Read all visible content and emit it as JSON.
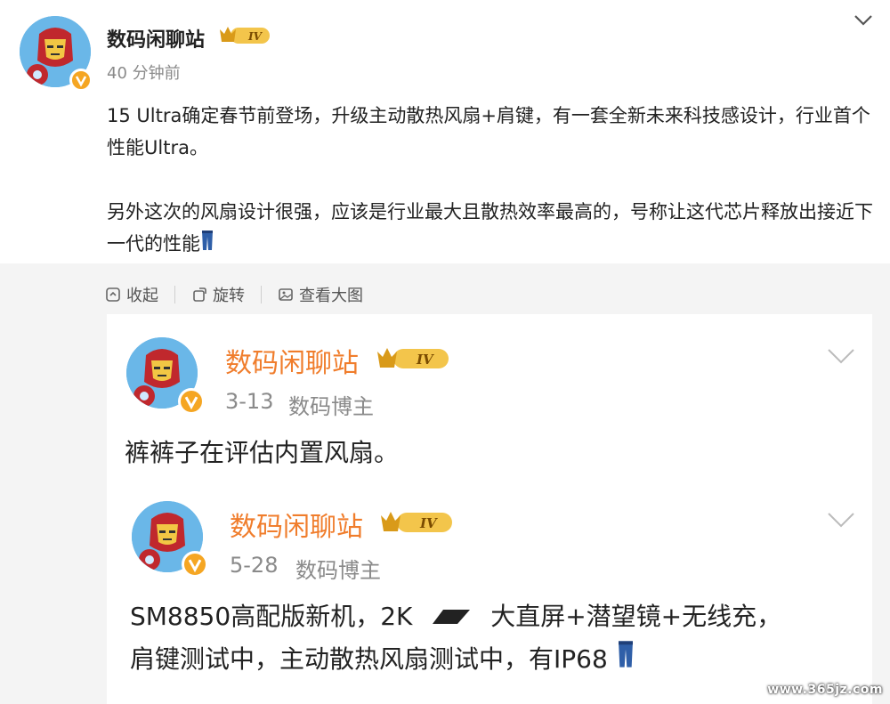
{
  "post": {
    "username": "数码闲聊站",
    "level": "IV",
    "time": "40 分钟前",
    "paragraph1": "15 Ultra确定春节前登场，升级主动散热风扇+肩键，有一套全新未来科技感设计，行业首个性能Ultra。",
    "paragraph2": "另外这次的风扇设计很强，应该是行业最大且散热效率最高的，号称让这代芯片释放出接近下一代的性能",
    "emoji": "jeans-emoji",
    "actions": [
      {
        "label": "收起",
        "icon": "collapse-icon"
      },
      {
        "label": "旋转",
        "icon": "rotate-icon"
      },
      {
        "label": "查看大图",
        "icon": "image-icon"
      }
    ]
  },
  "quote1": {
    "username": "数码闲聊站",
    "level": "IV",
    "date": "3-13",
    "role": "数码博主",
    "text": "裤裤子在评估内置风扇。"
  },
  "quote2": {
    "username": "数码闲聊站",
    "level": "IV",
    "date": "5-28",
    "role": "数码博主",
    "text_line1_a": "SM8850高配版新机，2K",
    "text_line1_b": "大直屏+潜望镜+无线充，",
    "text_line2": "肩键测试中，主动散热风扇测试中，有IP68"
  },
  "watermark": "www.365jz.com",
  "colors": {
    "name_orange": "#f07d2c",
    "meta_gray": "#8a8a8a",
    "verify_badge": "#f5a623",
    "card_bg": "#ffffff",
    "page_bg": "#f4f4f4"
  }
}
